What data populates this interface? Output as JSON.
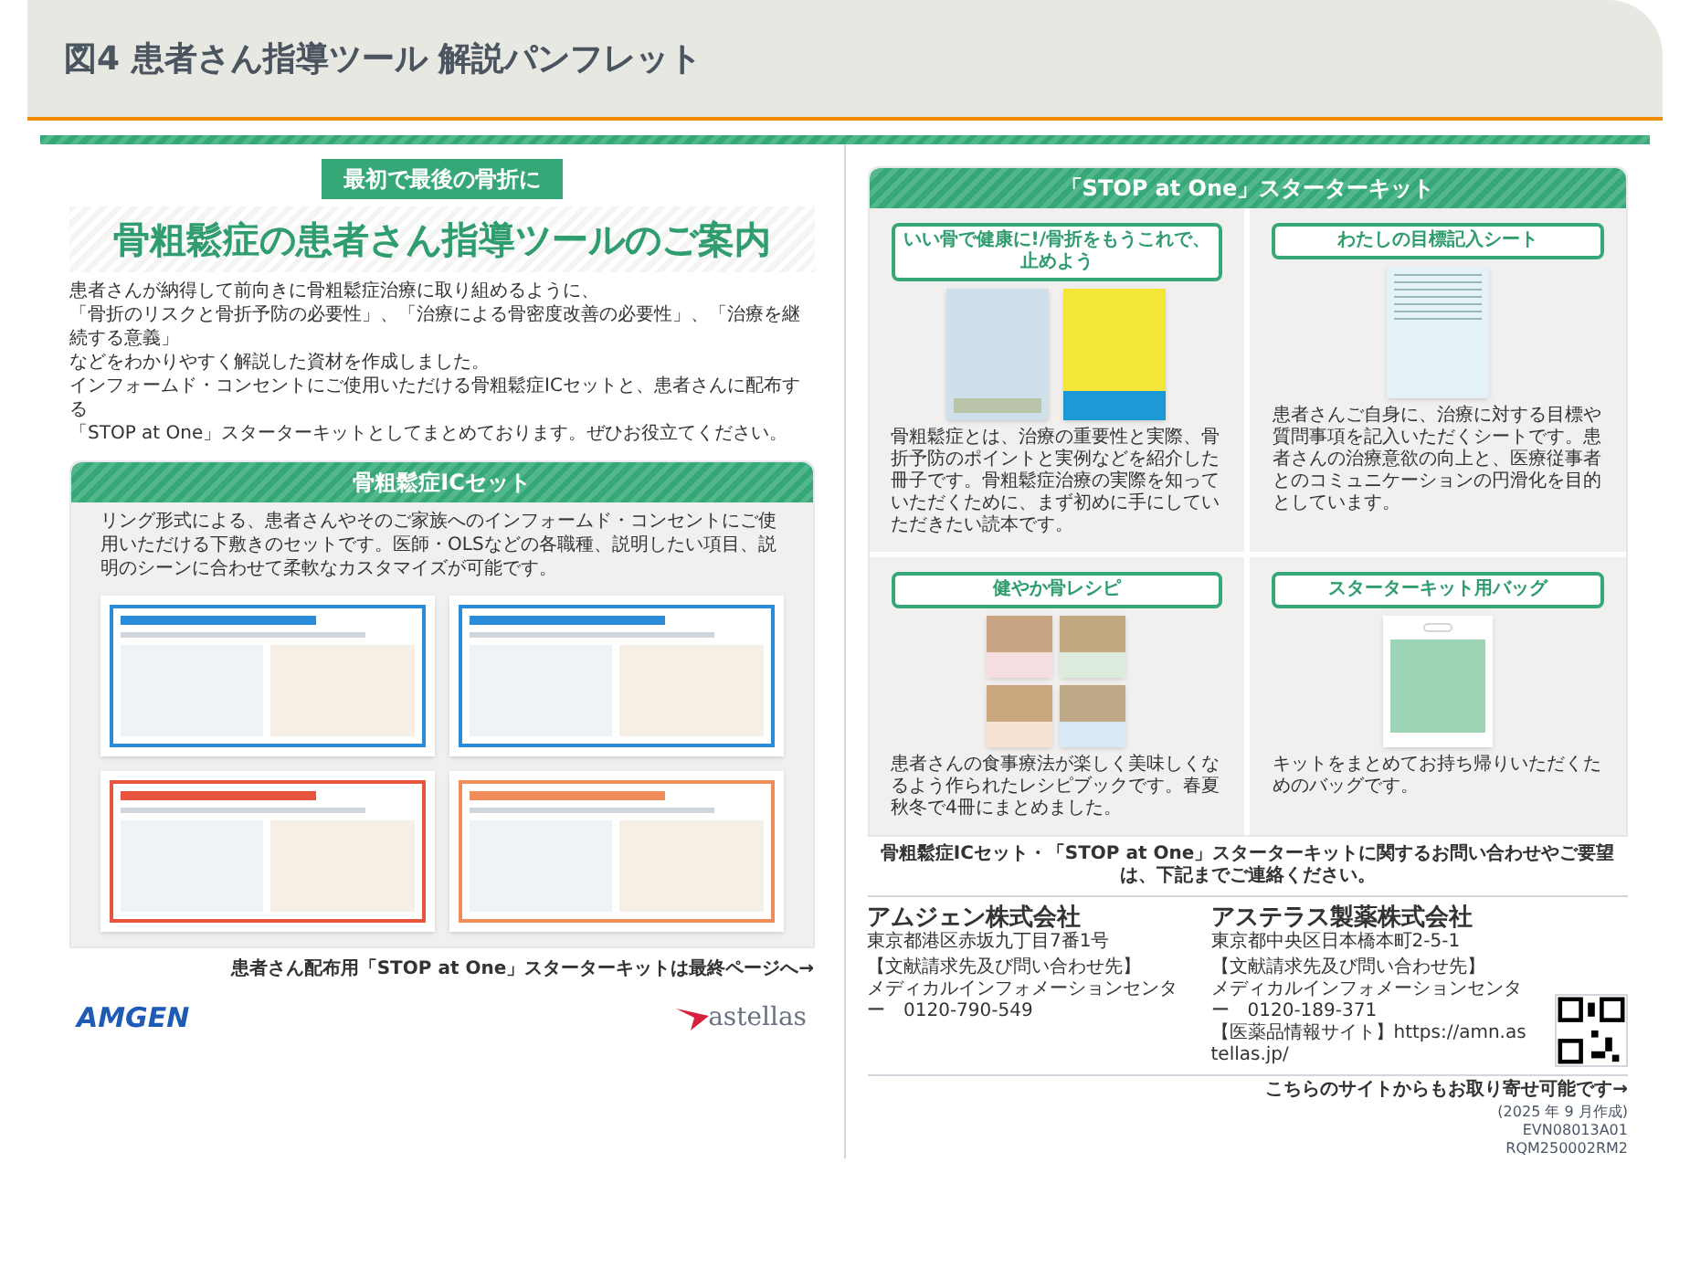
{
  "header": {
    "title": "図4 患者さん指導ツール 解説パンフレット"
  },
  "left_page": {
    "tagline": "最初で最後の骨折に",
    "title": "骨粗鬆症の患者さん指導ツールのご案内",
    "intro": [
      "患者さんが納得して前向きに骨粗鬆症治療に取り組めるように、",
      "「骨折のリスクと骨折予防の必要性」、「治療による骨密度改善の必要性」、「治療を継続する意義」",
      "などをわかりやすく解説した資材を作成しました。",
      "インフォームド・コンセントにご使用いただける骨粗鬆症ICセットと、患者さんに配布する",
      "「STOP at One」スターターキットとしてまとめております。ぜひお役立てください。"
    ],
    "ic_set": {
      "title": "骨粗鬆症ICセット",
      "description": "リング形式による、患者さんやそのご家族へのインフォームド・コンセントにご使用いただける下敷きのセットです。医師・OLSなどの各職種、説明したい項目、説明のシーンに合わせて柔軟なカスタマイズが可能です。"
    },
    "link": "患者さん配布用「STOP at One」スターターキットは最終ページへ→",
    "logos": [
      "AMGEN",
      "astellas"
    ]
  },
  "right_page": {
    "kit_title": "「STOP at One」スターターキット",
    "items": [
      {
        "kind": "booklets",
        "label": "いい骨で健康に!/骨折をもうこれで、止めよう",
        "description": "骨粗鬆症とは、治療の重要性と実際、骨折予防のポイントと実例などを紹介した冊子です。骨粗鬆症治療の実際を知っていただくために、まず初めに手にしていただきたい読本です。"
      },
      {
        "kind": "sheet",
        "label": "わたしの目標記入シート",
        "description": "患者さんご自身に、治療に対する目標や質問事項を記入いただくシートです。患者さんの治療意欲の向上と、医療従事者とのコミュニケーションの円滑化を目的としています。"
      },
      {
        "kind": "recipes",
        "label": "健やか骨レシピ",
        "description": "患者さんの食事療法が楽しく美味しくなるよう作られたレシピブックです。春夏秋冬で4冊にまとめました。"
      },
      {
        "kind": "bag",
        "label": "スターターキット用バッグ",
        "description": "キットをまとめてお持ち帰りいただくためのバッグです。"
      }
    ],
    "contact_intro": "骨粗鬆症ICセット・「STOP at One」スターターキットに関するお問い合わせやご要望は、下記までご連絡ください。",
    "companies": [
      {
        "name": "アムジェン株式会社",
        "address": "東京都港区赤坂九丁目7番1号",
        "lines": [
          "【文献請求先及び問い合わせ先】",
          "メディカルインフォメーションセンター　0120-790-549"
        ]
      },
      {
        "name": "アステラス製薬株式会社",
        "address": "東京都中央区日本橋本町2-5-1",
        "lines": [
          "【文献請求先及び問い合わせ先】",
          "メディカルインフォメーションセンター　0120-189-371",
          "【医薬品情報サイト】https://amn.astellas.jp/"
        ]
      }
    ],
    "qr_note": "こちらのサイトからもお取り寄せ可能です→",
    "codes": [
      "(2025 年 9 月作成)",
      "EVN08013A01",
      "RQM250002RM2"
    ]
  }
}
